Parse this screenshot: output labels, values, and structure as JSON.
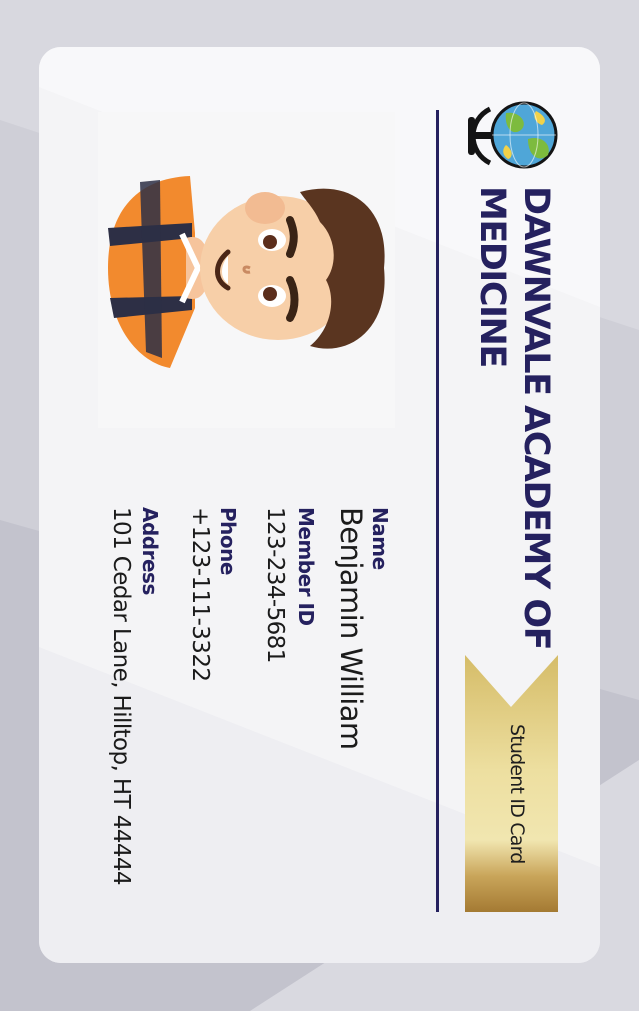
{
  "card": {
    "school_line1": "DAWNVALE ACADEMY OF",
    "school_line2": "MEDICINE",
    "card_type": "Student ID Card",
    "logo_icon": "globe-icon",
    "photo_icon": "student-avatar",
    "fields": {
      "name_label": "Name",
      "name_value": "Benjamin William",
      "member_label": "Member ID",
      "member_value": "123-234-5681",
      "phone_label": "Phone",
      "phone_value": "+123-111-3322",
      "address_label": "Address",
      "address_value": "101 Cedar Lane, Hilltop, HT 44444"
    }
  },
  "colors": {
    "navy": "#25215f",
    "gold": "#d8c06a",
    "card_bg": "#f4f4f6",
    "page_bg": "#c9c9d2"
  }
}
